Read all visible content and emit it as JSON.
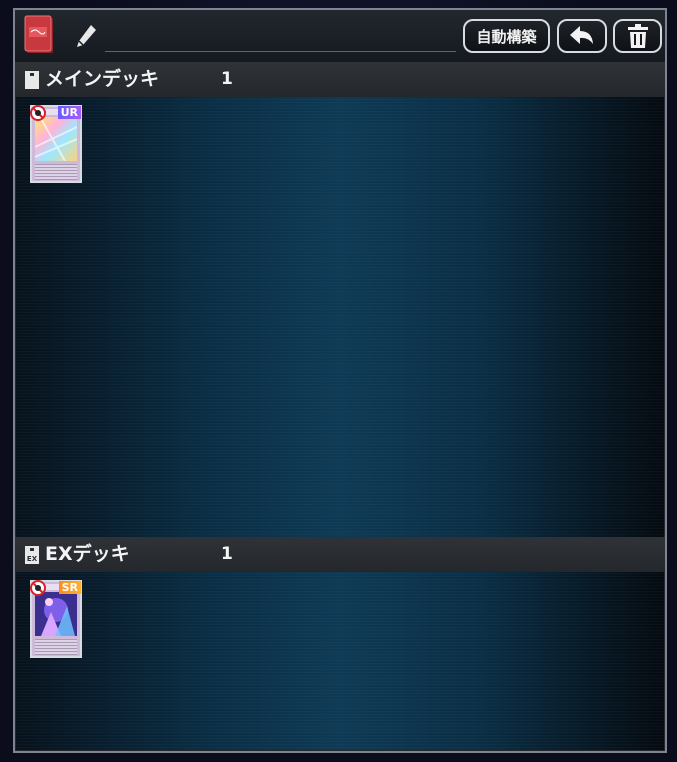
{
  "header": {
    "deck_name": "",
    "auto_build_label": "自動構築",
    "icons": [
      "deck-box-icon",
      "pencil-icon",
      "undo-arrow-icon",
      "trash-icon"
    ]
  },
  "main_deck": {
    "label": "メインデッキ",
    "count": "1",
    "cards": [
      {
        "rarity": "UR",
        "restricted": true
      }
    ]
  },
  "ex_deck": {
    "label": "EXデッキ",
    "count": "1",
    "icon_text": "EX",
    "cards": [
      {
        "rarity": "SR",
        "restricted": true
      }
    ]
  },
  "colors": {
    "ur_badge": "#8a5cff",
    "sr_badge": "#ff9a20",
    "panel_border": "#7c8591",
    "deck_box": "#c8383f"
  }
}
